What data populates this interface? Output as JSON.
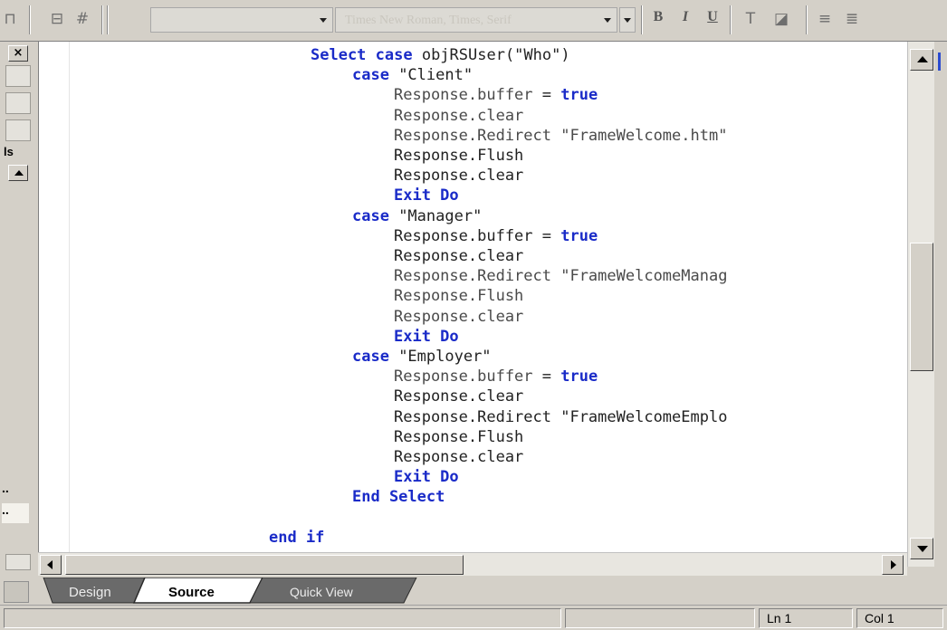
{
  "toolbar": {
    "font_name_ghost": "Times New Roman, Times, Serif",
    "bold_label": "B",
    "italic_label": "I",
    "underline_label": "U",
    "icons": [
      "properties-icon",
      "grid-icon",
      "text-color-icon",
      "highlight-icon",
      "align-left-icon",
      "align-center-icon"
    ]
  },
  "left_panel": {
    "close_label": "×",
    "text_fragment": "ls",
    "dots_1": "..",
    "dots_2": ".."
  },
  "code": {
    "lines": [
      {
        "parts": [
          {
            "t": "Select case",
            "c": "kw"
          },
          {
            "t": " objRSUser(\"Who\")",
            "c": "tx"
          }
        ],
        "indent": 0
      },
      {
        "parts": [
          {
            "t": "case",
            "c": "kw"
          },
          {
            "t": " \"Client\"",
            "c": "str"
          }
        ],
        "indent": 1
      },
      {
        "parts": [
          {
            "t": "Response.buffer",
            "c": "wk"
          },
          {
            "t": " = ",
            "c": "tx"
          },
          {
            "t": "true",
            "c": "kw"
          }
        ],
        "indent": 2
      },
      {
        "parts": [
          {
            "t": "Response.clear",
            "c": "wk"
          }
        ],
        "indent": 2
      },
      {
        "parts": [
          {
            "t": "Response.Redirect \"FrameWelcome.htm\"",
            "c": "wk"
          }
        ],
        "indent": 2
      },
      {
        "parts": [
          {
            "t": "Response.Flush",
            "c": "tx"
          }
        ],
        "indent": 2
      },
      {
        "parts": [
          {
            "t": "Response.clear",
            "c": "tx"
          }
        ],
        "indent": 2
      },
      {
        "parts": [
          {
            "t": "Exit Do",
            "c": "kw"
          }
        ],
        "indent": 2
      },
      {
        "parts": [
          {
            "t": "case",
            "c": "kw"
          },
          {
            "t": " \"Manager\"",
            "c": "tx"
          }
        ],
        "indent": 1
      },
      {
        "parts": [
          {
            "t": "Response.buffer",
            "c": "tx"
          },
          {
            "t": " = ",
            "c": "tx"
          },
          {
            "t": "true",
            "c": "kw"
          }
        ],
        "indent": 2
      },
      {
        "parts": [
          {
            "t": "Response.clear",
            "c": "tx"
          }
        ],
        "indent": 2
      },
      {
        "parts": [
          {
            "t": "Response.Redirect \"FrameWelcomeManag",
            "c": "wk"
          }
        ],
        "indent": 2
      },
      {
        "parts": [
          {
            "t": "Response.Flush",
            "c": "wk"
          }
        ],
        "indent": 2
      },
      {
        "parts": [
          {
            "t": "Response.clear",
            "c": "wk"
          }
        ],
        "indent": 2
      },
      {
        "parts": [
          {
            "t": "Exit Do",
            "c": "kw"
          }
        ],
        "indent": 2
      },
      {
        "parts": [
          {
            "t": "case",
            "c": "kw"
          },
          {
            "t": " \"Employer\"",
            "c": "tx"
          }
        ],
        "indent": 1
      },
      {
        "parts": [
          {
            "t": "Response.buffer",
            "c": "wk"
          },
          {
            "t": " = ",
            "c": "tx"
          },
          {
            "t": "true",
            "c": "kw"
          }
        ],
        "indent": 2
      },
      {
        "parts": [
          {
            "t": "Response.clear",
            "c": "tx"
          }
        ],
        "indent": 2
      },
      {
        "parts": [
          {
            "t": "Response.Redirect \"FrameWelcomeEmplo",
            "c": "tx"
          }
        ],
        "indent": 2
      },
      {
        "parts": [
          {
            "t": "Response.Flush",
            "c": "tx"
          }
        ],
        "indent": 2
      },
      {
        "parts": [
          {
            "t": "Response.clear",
            "c": "tx"
          }
        ],
        "indent": 2
      },
      {
        "parts": [
          {
            "t": "Exit Do",
            "c": "kw"
          }
        ],
        "indent": 2
      },
      {
        "parts": [
          {
            "t": "End Select",
            "c": "kw"
          }
        ],
        "indent": 1
      },
      {
        "parts": [
          {
            "t": "",
            "c": "tx"
          }
        ],
        "indent": 0
      },
      {
        "parts": [
          {
            "t": "end if",
            "c": "kw"
          }
        ],
        "indent": -1
      }
    ]
  },
  "tabs": [
    {
      "label": "Design",
      "active": false
    },
    {
      "label": "Source",
      "active": true
    },
    {
      "label": "Quick View",
      "active": false
    }
  ],
  "status": {
    "line": "Ln 1",
    "col": "Col 1"
  },
  "colors": {
    "keyword": "#1a2bc8",
    "text": "#222222",
    "chrome": "#d4d0c8",
    "inactive_tab": "#4a4a4a"
  }
}
